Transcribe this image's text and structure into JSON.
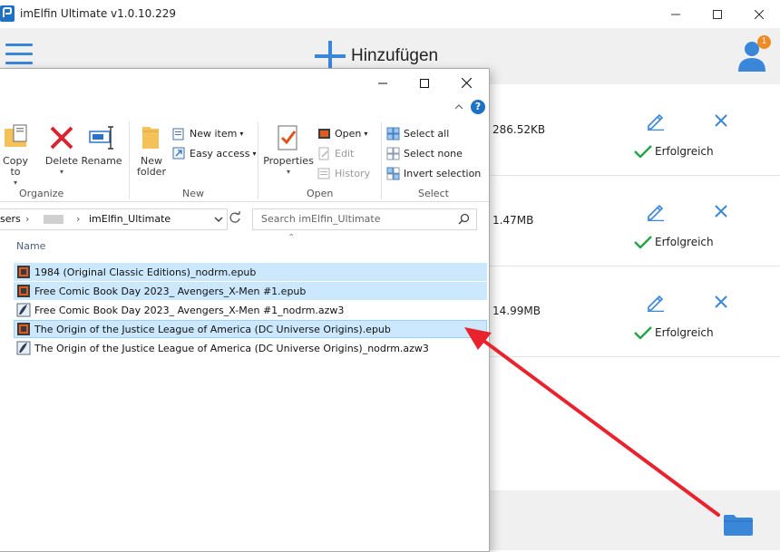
{
  "app": {
    "title": "imElfin Ultimate v1.0.10.229",
    "add_label": "Hinzufügen",
    "notification_count": "1",
    "accent_color": "#3a86d8"
  },
  "rows": [
    {
      "size": "286.52KB",
      "status": "Erfolgreich"
    },
    {
      "size": "1.47MB",
      "status": "Erfolgreich"
    },
    {
      "size": "14.99MB",
      "status": "Erfolgreich"
    }
  ],
  "explorer": {
    "ribbon": {
      "organize": {
        "label": "Organize",
        "copy_to": "Copy to",
        "delete": "Delete",
        "rename": "Rename"
      },
      "new": {
        "label": "New",
        "new_folder": "New folder",
        "new_item": "New item",
        "easy_access": "Easy access"
      },
      "open": {
        "label": "Open",
        "properties": "Properties",
        "open": "Open",
        "edit": "Edit",
        "history": "History"
      },
      "select": {
        "label": "Select",
        "select_all": "Select all",
        "select_none": "Select none",
        "invert_selection": "Invert selection"
      }
    },
    "address": {
      "prefix": "sers",
      "folder": "imElfin_Ultimate"
    },
    "search_placeholder": "Search imElfin_Ultimate",
    "column_name": "Name",
    "files": [
      {
        "name": "1984 (Original Classic Editions)_nodrm.epub",
        "type": "epub",
        "selected": true
      },
      {
        "name": "Free Comic Book Day 2023_ Avengers_X-Men #1.epub",
        "type": "epub",
        "selected": true
      },
      {
        "name": "Free Comic Book Day 2023_ Avengers_X-Men #1_nodrm.azw3",
        "type": "azw3",
        "selected": false
      },
      {
        "name": "The Origin of the Justice League of America (DC Universe Origins).epub",
        "type": "epub",
        "selected": true
      },
      {
        "name": "The Origin of the Justice League of America (DC Universe Origins)_nodrm.azw3",
        "type": "azw3",
        "selected": false
      }
    ]
  },
  "icons": [
    "hamburger-icon",
    "plus-icon",
    "user-icon",
    "edit-icon",
    "delete-icon",
    "check-icon",
    "folder-icon",
    "refresh-icon",
    "search-icon",
    "help-icon"
  ]
}
